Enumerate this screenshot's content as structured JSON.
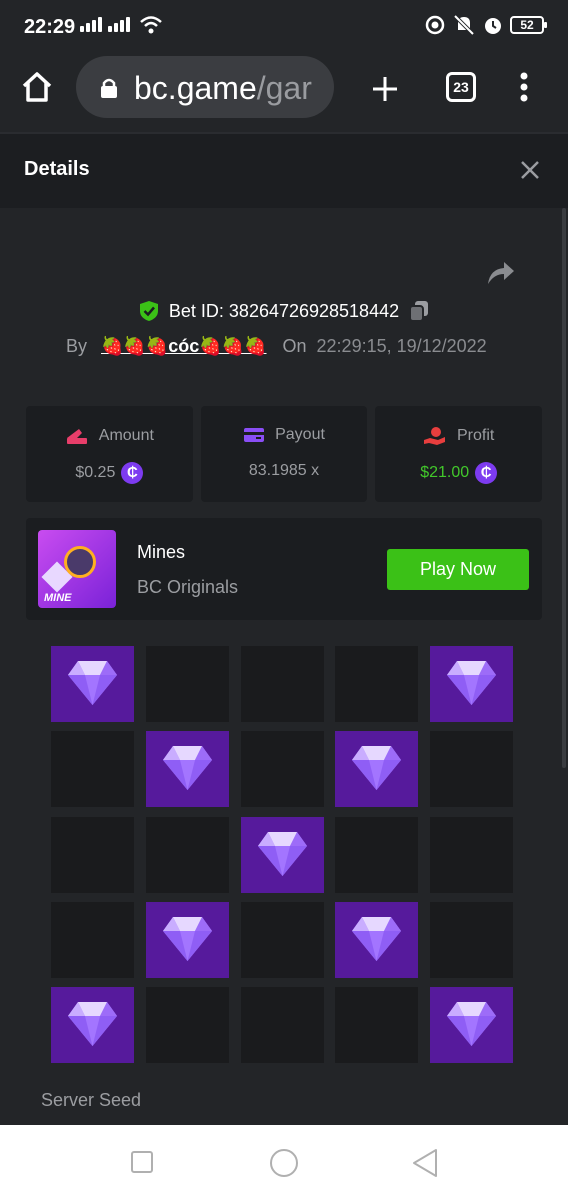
{
  "status_bar": {
    "time": "22:29",
    "battery": "52"
  },
  "browser": {
    "url_domain": "bc.game",
    "url_path": "/gar",
    "tab_count": "23"
  },
  "header": {
    "title": "Details"
  },
  "bet": {
    "id_label": "Bet ID:",
    "id_value": "38264726928518442",
    "by_label": "By",
    "username": "🍓🍓🍓cóc🍓🍓🍓",
    "on_label": "On",
    "datetime": "22:29:15, 19/12/2022"
  },
  "stats": {
    "amount": {
      "label": "Amount",
      "value": "$0.25"
    },
    "payout": {
      "label": "Payout",
      "value": "83.1985 x"
    },
    "profit": {
      "label": "Profit",
      "value": "$21.00"
    }
  },
  "coin_symbol": "₵",
  "game": {
    "thumb_text": "MINE",
    "name": "Mines",
    "provider": "BC Originals",
    "play_label": "Play Now"
  },
  "board": {
    "rows": [
      [
        true,
        false,
        false,
        false,
        true
      ],
      [
        false,
        true,
        false,
        true,
        false
      ],
      [
        false,
        false,
        true,
        false,
        false
      ],
      [
        false,
        true,
        false,
        true,
        false
      ],
      [
        true,
        false,
        false,
        false,
        true
      ]
    ]
  },
  "server_seed": {
    "label": "Server Seed"
  },
  "colors": {
    "background": "#232528",
    "panel": "#1b1d20",
    "gem_tile": "#561a9c",
    "play_button": "#3bc117",
    "profit_green": "#42c82b",
    "coin_purple": "#7d3bf0"
  }
}
